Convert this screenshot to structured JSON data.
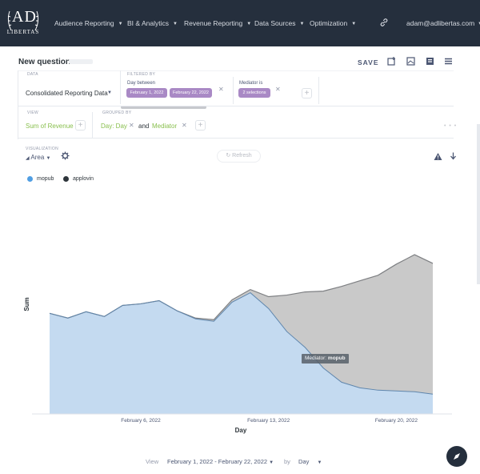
{
  "nav": {
    "items": [
      {
        "label": "Audience Reporting"
      },
      {
        "label": "BI & Analytics"
      },
      {
        "label": "Revenue Reporting"
      },
      {
        "label": "Data Sources"
      },
      {
        "label": "Optimization"
      }
    ],
    "user": "adam@adlibertas.com",
    "logo_text": "AD LIBERTAS"
  },
  "header": {
    "title": "New question",
    "save_label": "SAVE"
  },
  "editor": {
    "data_label": "DATA",
    "data_source": "Consolidated Reporting Data",
    "filtered_by_label": "FILTERED BY",
    "filter_day": {
      "label": "Day between",
      "start": "February 1, 2022",
      "end": "February 22, 2022"
    },
    "filter_mediator": {
      "label": "Mediator is",
      "value": "2 selections"
    },
    "view_label": "VIEW",
    "view_value": "Sum of Revenue",
    "grouped_by_label": "GROUPED BY",
    "group_1": "Day: Day",
    "and_label": "and",
    "group_2": "Mediator"
  },
  "visualization": {
    "label": "VISUALIZATION",
    "type": "Area",
    "refresh_label": "Refresh"
  },
  "tooltip": {
    "key": "Mediator:",
    "value": "mopub"
  },
  "footer": {
    "view_label": "View",
    "date_range": "February 1, 2022 - February 22, 2022",
    "by_label": "by",
    "granularity": "Day"
  },
  "colors": {
    "mopub": "#509ee3",
    "applovin": "#2e353b",
    "nav_bg": "#252f3d",
    "filter_pill": "#a989c5",
    "summarize_green": "#88bf4d"
  },
  "chart_data": {
    "type": "area",
    "stacked": true,
    "xlabel": "Day",
    "ylabel": "Sum",
    "x": [
      "2022-02-01",
      "2022-02-02",
      "2022-02-03",
      "2022-02-04",
      "2022-02-05",
      "2022-02-06",
      "2022-02-07",
      "2022-02-08",
      "2022-02-09",
      "2022-02-10",
      "2022-02-11",
      "2022-02-12",
      "2022-02-13",
      "2022-02-14",
      "2022-02-15",
      "2022-02-16",
      "2022-02-17",
      "2022-02-18",
      "2022-02-19",
      "2022-02-20",
      "2022-02-21",
      "2022-02-22"
    ],
    "x_tick_labels": [
      "February 6, 2022",
      "February 13, 2022",
      "February 20, 2022"
    ],
    "series": [
      {
        "name": "mopub",
        "values": [
          87,
          81,
          89,
          83,
          97,
          99,
          103,
          90,
          80,
          77,
          101,
          113,
          93,
          64,
          44,
          18,
          0,
          -7,
          -10,
          -11,
          -12,
          -15
        ]
      },
      {
        "name": "applovin",
        "values": [
          0,
          0,
          0,
          0,
          0,
          0,
          0,
          0,
          1,
          2,
          3,
          4,
          15,
          46,
          70,
          97,
          121,
          135,
          145,
          160,
          173,
          165
        ]
      }
    ],
    "legend_position": "top-left",
    "grid": false
  }
}
